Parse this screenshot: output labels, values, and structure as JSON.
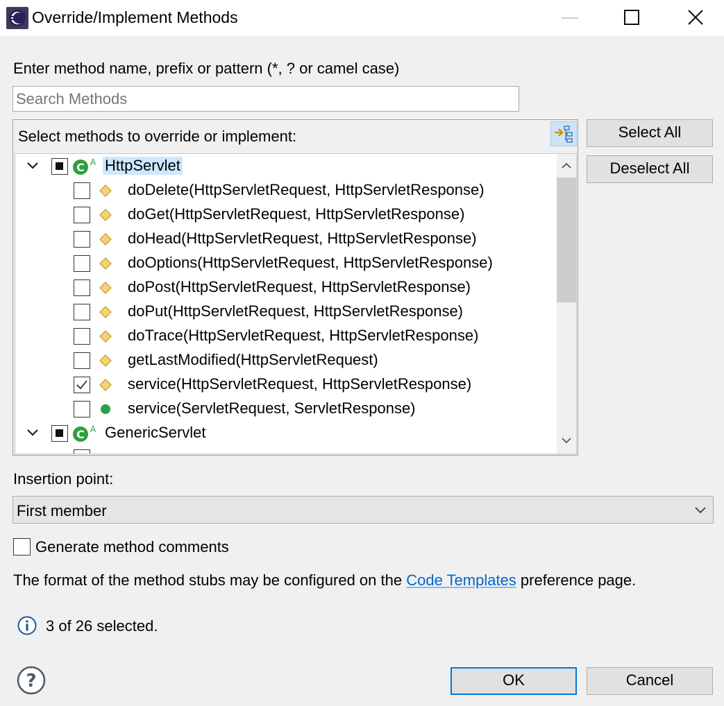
{
  "window": {
    "title": "Override/Implement Methods"
  },
  "search": {
    "label": "Enter method name, prefix or pattern (*, ? or camel case)",
    "placeholder": "Search Methods",
    "value": ""
  },
  "methods_group": {
    "header": "Select methods to override or implement:",
    "sort_button_icon": "sort-by-hierarchy-icon"
  },
  "tree": {
    "classes": [
      {
        "name": "HttpServlet",
        "check_state": "partial",
        "expanded": true,
        "selected": true,
        "methods": [
          {
            "label": "doDelete(HttpServletRequest, HttpServletResponse)",
            "checked": false,
            "visibility": "protected"
          },
          {
            "label": "doGet(HttpServletRequest, HttpServletResponse)",
            "checked": false,
            "visibility": "protected"
          },
          {
            "label": "doHead(HttpServletRequest, HttpServletResponse)",
            "checked": false,
            "visibility": "protected"
          },
          {
            "label": "doOptions(HttpServletRequest, HttpServletResponse)",
            "checked": false,
            "visibility": "protected"
          },
          {
            "label": "doPost(HttpServletRequest, HttpServletResponse)",
            "checked": false,
            "visibility": "protected"
          },
          {
            "label": "doPut(HttpServletRequest, HttpServletResponse)",
            "checked": false,
            "visibility": "protected"
          },
          {
            "label": "doTrace(HttpServletRequest, HttpServletResponse)",
            "checked": false,
            "visibility": "protected"
          },
          {
            "label": "getLastModified(HttpServletRequest)",
            "checked": false,
            "visibility": "protected"
          },
          {
            "label": "service(HttpServletRequest, HttpServletResponse)",
            "checked": true,
            "visibility": "protected"
          },
          {
            "label": "service(ServletRequest, ServletResponse)",
            "checked": false,
            "visibility": "public"
          }
        ]
      },
      {
        "name": "GenericServlet",
        "check_state": "partial",
        "expanded": true,
        "selected": false,
        "methods": []
      }
    ]
  },
  "buttons": {
    "select_all": "Select All",
    "deselect_all": "Deselect All",
    "ok": "OK",
    "cancel": "Cancel"
  },
  "insertion": {
    "label": "Insertion point:",
    "selected": "First member"
  },
  "generate_comments": {
    "label": "Generate method comments",
    "checked": false
  },
  "info": {
    "prefix": "The format of the method stubs may be configured on the ",
    "link": "Code Templates",
    "suffix": " preference page."
  },
  "status": {
    "text": "3 of 26 selected."
  },
  "colors": {
    "selection": "#cce8ff",
    "link": "#0066cc",
    "class_icon_green": "#2e9e3e",
    "protected_method_yellow": "#f4d27a",
    "public_method_green": "#2ea043",
    "default_button_border": "#0078d7"
  }
}
